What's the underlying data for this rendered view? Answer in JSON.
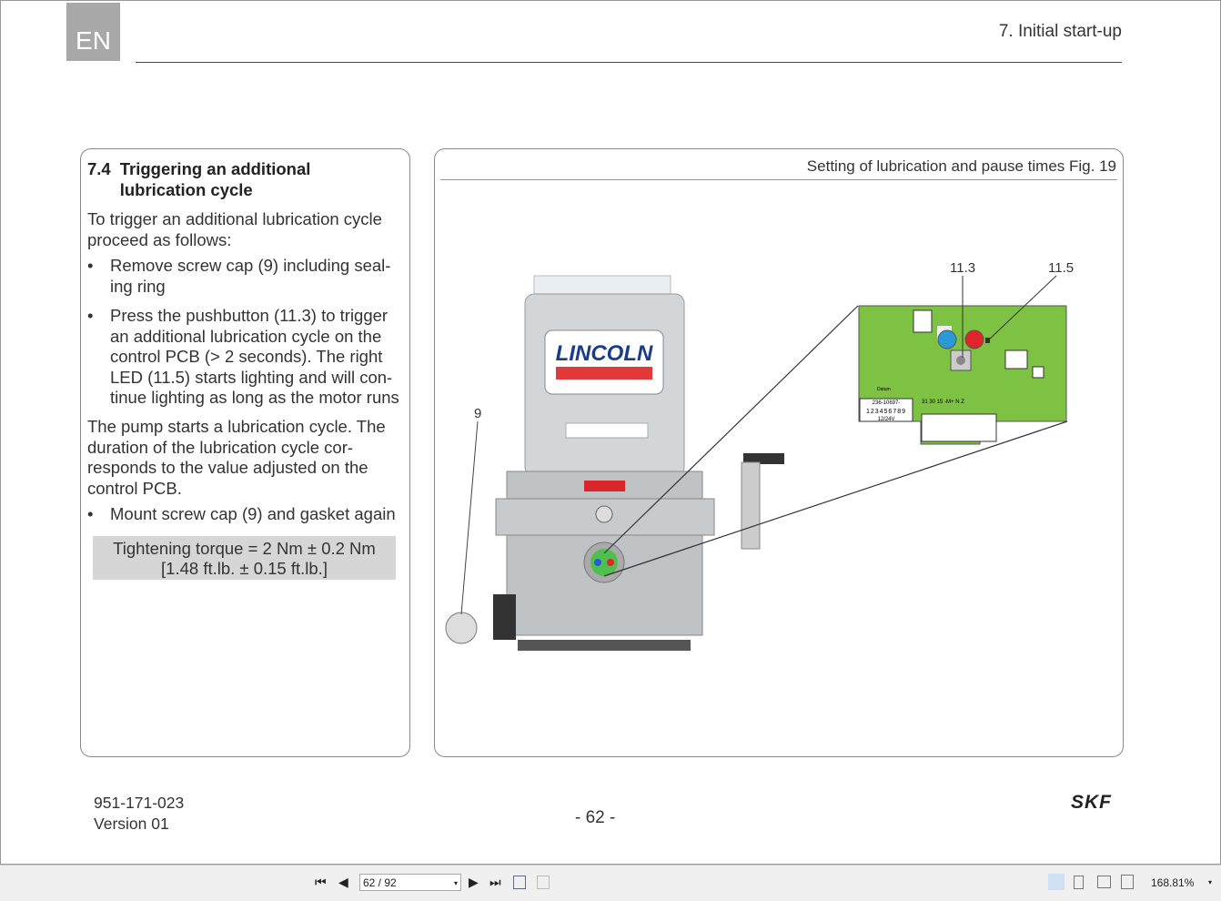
{
  "header": {
    "lang": "EN",
    "chapter": "7. Initial start-up"
  },
  "section": {
    "number": "7.4",
    "title": "Triggering an additional lubrication cycle",
    "intro": "To trigger an additional lubrication cycle proceed as follows:",
    "bullets": [
      "Remove screw cap (9) including seal-ing ring",
      "Press the pushbutton (11.3) to trigger an additional lubrication cycle on the control PCB (> 2 seconds). The right LED (11.5) starts lighting and will con-tinue lighting as long as the motor runs"
    ],
    "para": "The pump starts a lubrication cycle. The duration of the lubrication cycle cor-responds to the value adjusted on the control PCB.",
    "bullet_last": "Mount screw cap (9) and gasket again",
    "torque_line1": "Tightening torque = 2 Nm ± 0.2 Nm",
    "torque_line2": "[1.48 ft.lb. ± 0.15 ft.lb.]",
    "bullet_char": "•"
  },
  "figure": {
    "caption": "Setting of lubrication and pause times Fig. 19",
    "labels": {
      "cap": "9",
      "button": "11.3",
      "led": "11.5"
    },
    "logo": "LINCOLN",
    "pcb": {
      "datum": "Datum",
      "part": "236-10697-",
      "digits": "123456789",
      "voltage": "12/24V",
      "terminals": "31 30 15 -M+ N Z"
    }
  },
  "footer": {
    "doc_number": "951-171-023",
    "version": "Version 01",
    "page": "- 62 -",
    "brand": "SKF"
  },
  "toolbar": {
    "page_field": "62 / 92",
    "zoom": "168.81%",
    "first": "⏮",
    "prev": "◀",
    "next": "▶",
    "last": "⏭",
    "dropdown": "▾"
  },
  "colors": {
    "pcb": "#7dc242",
    "led_blue": "#2a9ad6",
    "led_red": "#e0262a",
    "header_gray": "#a8a8a8"
  }
}
